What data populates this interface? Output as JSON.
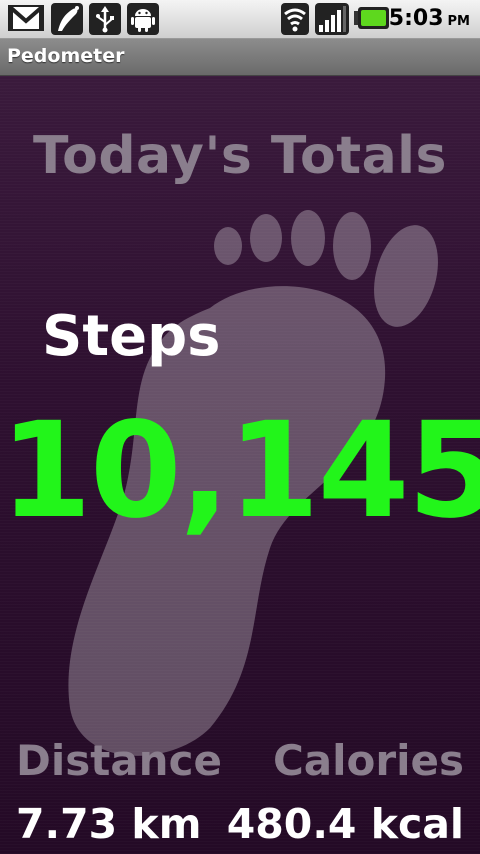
{
  "status_bar": {
    "icons": [
      "gmail-icon",
      "pedometer-notification-icon",
      "usb-icon",
      "android-debug-icon",
      "wifi-icon",
      "signal-icon",
      "battery-icon"
    ],
    "time": "5:03",
    "ampm": "PM"
  },
  "app": {
    "title": "Pedometer"
  },
  "main": {
    "heading": "Today's Totals",
    "steps_label": "Steps",
    "steps_value": "10,145",
    "distance_label": "Distance",
    "distance_value": "7.73 km",
    "calories_label": "Calories",
    "calories_value": "480.4 kcal"
  },
  "colors": {
    "steps_value": "#22f51a",
    "label_muted": "#8a7e8d",
    "background": "#2e1030"
  }
}
